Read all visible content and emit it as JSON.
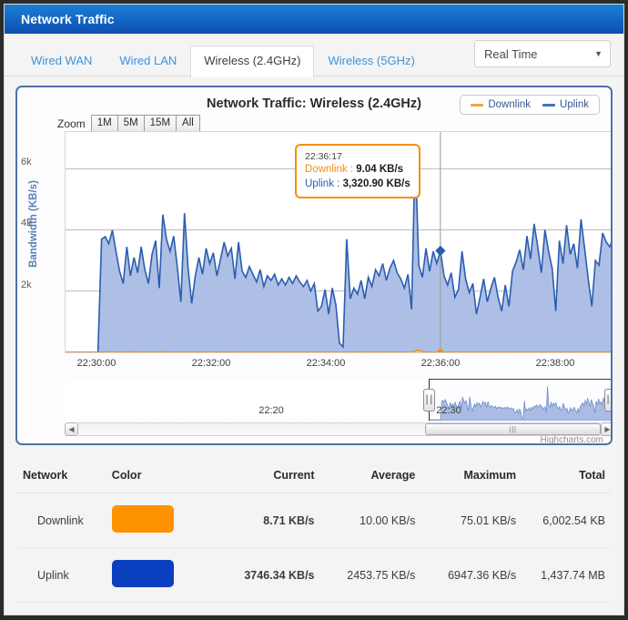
{
  "window": {
    "title": "Network Traffic"
  },
  "tabs": [
    {
      "label": "Wired WAN",
      "active": false
    },
    {
      "label": "Wired LAN",
      "active": false
    },
    {
      "label": "Wireless (2.4GHz)",
      "active": true
    },
    {
      "label": "Wireless (5GHz)",
      "active": false
    }
  ],
  "range_select": {
    "value": "Real Time",
    "caret": "chevron-down-icon"
  },
  "chart": {
    "title": "Network Traffic: Wireless (2.4GHz)",
    "zoom_label": "Zoom",
    "zoom_buttons": [
      "1M",
      "5M",
      "15M",
      "All"
    ],
    "credit": "Highcharts.com",
    "legend": [
      {
        "label": "Downlink",
        "color": "#f7a33c"
      },
      {
        "label": "Uplink",
        "color": "#4470c4"
      }
    ],
    "tooltip": {
      "time": "22:36:17",
      "rows": [
        {
          "name": "Downlink :",
          "value": "9.04 KB/s",
          "color": "#f5900a"
        },
        {
          "name": "Uplink :",
          "value": "3,320.90 KB/s",
          "color": "#2a5db0"
        }
      ]
    },
    "navigator": {
      "labels": [
        "22:20",
        "22:30"
      ]
    },
    "scrollbar": {
      "left_arrow": "arrow-left-icon",
      "right_arrow": "arrow-right-icon",
      "grip": "|||"
    }
  },
  "chart_data": {
    "type": "area",
    "title": "Network Traffic: Wireless (2.4GHz)",
    "xlabel": "",
    "ylabel": "Bandwidth (KB/s)",
    "ylim": [
      0,
      7200
    ],
    "yticks": [
      2000,
      4000,
      6000
    ],
    "ytick_labels": [
      "2k",
      "4k",
      "6k"
    ],
    "xticks": [
      "22:30:00",
      "22:32:00",
      "22:34:00",
      "22:36:00",
      "22:38:00"
    ],
    "xlim": [
      "22:29:30",
      "22:38:50"
    ],
    "grid": true,
    "legend_position": "top-right",
    "crosshair_x": "22:36:17",
    "series": [
      {
        "name": "Uplink",
        "color": "#2a5db0",
        "fill": "#aabce4",
        "unit": "KB/s",
        "values": [
          0,
          0,
          0,
          0,
          0,
          0,
          0,
          0,
          0,
          0,
          3700,
          3780,
          3550,
          3990,
          3300,
          2650,
          2250,
          3450,
          2500,
          3100,
          2600,
          3450,
          2700,
          2250,
          3200,
          3650,
          2100,
          4500,
          3700,
          3300,
          3800,
          2800,
          1650,
          4550,
          2750,
          1600,
          2500,
          3100,
          2550,
          3400,
          2900,
          3250,
          2500,
          3050,
          3600,
          3150,
          3400,
          2400,
          3600,
          2650,
          2450,
          2800,
          2550,
          2300,
          2700,
          2150,
          2500,
          2350,
          2550,
          2200,
          2400,
          2200,
          2450,
          2250,
          2500,
          2300,
          2150,
          2350,
          2000,
          2250,
          1350,
          1500,
          2050,
          1250,
          2100,
          1550,
          300,
          180,
          3700,
          1750,
          2100,
          1900,
          2350,
          1750,
          2450,
          2150,
          2700,
          2500,
          2900,
          2350,
          2750,
          3000,
          2600,
          2400,
          2100,
          2550,
          1400,
          6600,
          2850,
          2450,
          3400,
          2650,
          3300,
          2900,
          3320,
          2500,
          2200,
          2600,
          1800,
          2050,
          3300,
          2400,
          1950,
          2250,
          1250,
          1800,
          2400,
          1650,
          2100,
          2450,
          1800,
          1350,
          2200,
          1500,
          2650,
          2950,
          3350,
          2700,
          3800,
          3050,
          4200,
          3450,
          2600,
          4000,
          3300,
          2750,
          1350,
          3650,
          2900,
          4150,
          3200,
          3550,
          2750,
          4350,
          3400,
          2400,
          1500,
          3000,
          2850,
          3900,
          3600,
          3450,
          3750
        ]
      },
      {
        "name": "Downlink",
        "color": "#f5900a",
        "fill": "#f7c77f",
        "unit": "KB/s",
        "values": [
          0,
          0,
          0,
          0,
          0,
          0,
          0,
          0,
          0,
          0,
          12,
          8,
          30,
          6,
          9,
          14,
          7,
          5,
          22,
          9,
          6,
          11,
          8,
          4,
          15,
          9,
          6,
          28,
          10,
          7,
          9,
          5,
          12,
          8,
          6,
          10,
          7,
          9,
          5,
          14,
          8,
          6,
          11,
          7,
          9,
          5,
          25,
          8,
          6,
          10,
          7,
          12,
          5,
          9,
          6,
          8,
          11,
          7,
          9,
          5,
          14,
          8,
          6,
          10,
          7,
          9,
          5,
          12,
          8,
          6,
          9,
          7,
          11,
          5,
          8,
          10,
          6,
          4,
          9,
          7,
          12,
          6,
          8,
          5,
          10,
          7,
          9,
          6,
          11,
          8,
          5,
          9,
          7,
          10,
          6,
          8,
          12,
          40,
          75,
          18,
          9,
          7,
          11,
          6,
          9,
          8,
          5,
          10,
          7,
          9,
          6,
          12,
          8,
          5,
          9,
          7,
          10,
          6,
          8,
          11,
          5,
          9,
          7,
          12,
          6,
          8,
          10,
          5,
          9,
          7,
          11,
          6,
          8,
          9,
          5,
          10,
          7,
          12,
          6,
          8,
          9,
          5,
          11,
          7,
          9,
          6,
          8,
          10,
          5,
          9,
          7,
          8,
          9
        ]
      }
    ]
  },
  "table": {
    "headers": [
      "Network",
      "Color",
      "Current",
      "Average",
      "Maximum",
      "Total"
    ],
    "rows": [
      {
        "network": "Downlink",
        "color": "#ff9200",
        "current": "8.71 KB/s",
        "average": "10.00 KB/s",
        "maximum": "75.01 KB/s",
        "total": "6,002.54 KB"
      },
      {
        "network": "Uplink",
        "color": "#0a3fbf",
        "current": "3746.34 KB/s",
        "average": "2453.75 KB/s",
        "maximum": "6947.36 KB/s",
        "total": "1,437.74 MB"
      }
    ]
  }
}
